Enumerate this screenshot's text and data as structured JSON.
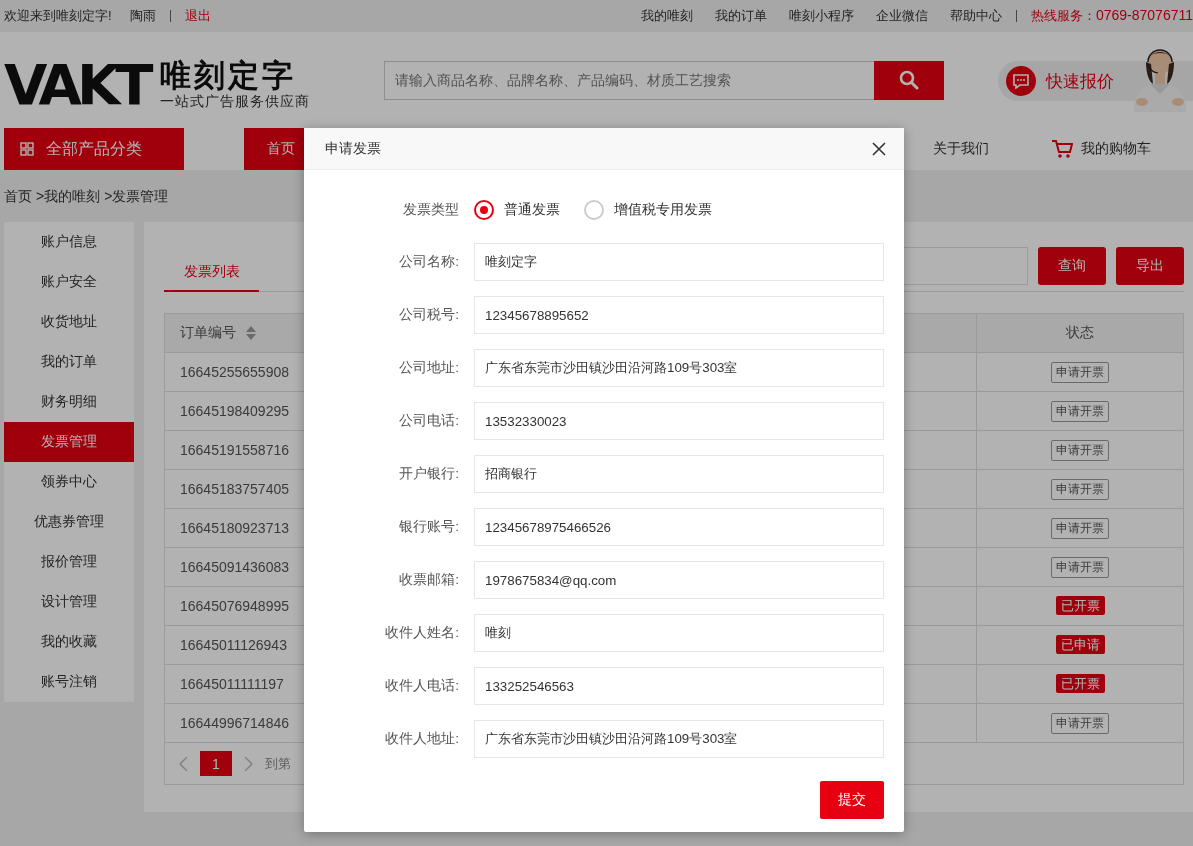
{
  "top_bar": {
    "welcome": "欢迎来到唯刻定字!",
    "username": "陶雨",
    "logout": "退出",
    "links": [
      "我的唯刻",
      "我的订单",
      "唯刻小程序",
      "企业微信",
      "帮助中心"
    ],
    "hotline_label": "热线服务：",
    "hotline": "0769-87076711"
  },
  "header": {
    "logo_mark": "VAKT",
    "logo_name": "唯刻定字",
    "slogan": "一站式广告服务供应商",
    "search": {
      "placeholder": "请输入商品名称、品牌名称、产品编码、材质工艺搜索"
    },
    "quick_quote": "快速报价"
  },
  "nav": {
    "category_button": "全部产品分类",
    "items": [
      {
        "label": "首页",
        "selected": true
      },
      {
        "label": "关于我们",
        "selected": false
      }
    ],
    "cart": "我的购物车"
  },
  "breadcrumb": [
    "首页",
    ">我的唯刻",
    ">发票管理"
  ],
  "sidebar": {
    "items": [
      {
        "label": "账户信息",
        "selected": false
      },
      {
        "label": "账户安全",
        "selected": false
      },
      {
        "label": "收货地址",
        "selected": false
      },
      {
        "label": "我的订单",
        "selected": false
      },
      {
        "label": "财务明细",
        "selected": false
      },
      {
        "label": "发票管理",
        "selected": true
      },
      {
        "label": "领券中心",
        "selected": false
      },
      {
        "label": "优惠券管理",
        "selected": false
      },
      {
        "label": "报价管理",
        "selected": false
      },
      {
        "label": "设计管理",
        "selected": false
      },
      {
        "label": "我的收藏",
        "selected": false
      },
      {
        "label": "账号注销",
        "selected": false
      }
    ]
  },
  "content": {
    "tabs": [
      {
        "label": "发票列表",
        "selected": true
      }
    ],
    "buttons": [
      "查询",
      "导出"
    ],
    "table": {
      "columns": [
        "订单编号",
        "状态"
      ],
      "rows": [
        {
          "order_no": "16645255655908",
          "status": "申请开票",
          "kind": "button"
        },
        {
          "order_no": "16645198409295",
          "status": "申请开票",
          "kind": "button"
        },
        {
          "order_no": "16645191558716",
          "status": "申请开票",
          "kind": "button"
        },
        {
          "order_no": "16645183757405",
          "status": "申请开票",
          "kind": "button"
        },
        {
          "order_no": "16645180923713",
          "status": "申请开票",
          "kind": "button"
        },
        {
          "order_no": "16645091436083",
          "status": "申请开票",
          "kind": "button"
        },
        {
          "order_no": "16645076948995",
          "status": "已开票",
          "kind": "badge"
        },
        {
          "order_no": "16645011126943",
          "status": "已申请",
          "kind": "badge"
        },
        {
          "order_no": "16645011111197",
          "status": "已开票",
          "kind": "badge"
        },
        {
          "order_no": "16644996714846",
          "status": "申请开票",
          "kind": "button"
        }
      ]
    },
    "pagination": {
      "pages": [
        {
          "label": "1",
          "selected": true
        }
      ],
      "goto": "到第"
    }
  },
  "dialog": {
    "title": "申请发票",
    "type_label": "发票类型",
    "type_options": [
      {
        "label": "普通发票",
        "selected": true
      },
      {
        "label": "增值税专用发票",
        "selected": false
      }
    ],
    "fields": [
      {
        "label": "公司名称:",
        "value": "唯刻定字"
      },
      {
        "label": "公司税号:",
        "value": "12345678895652"
      },
      {
        "label": "公司地址:",
        "value": "广东省东莞市沙田镇沙田沿河路109号303室"
      },
      {
        "label": "公司电话:",
        "value": "13532330023"
      },
      {
        "label": "开户银行:",
        "value": "招商银行"
      },
      {
        "label": "银行账号:",
        "value": "12345678975466526"
      },
      {
        "label": "收票邮箱:",
        "value": "1978675834@qq.com"
      },
      {
        "label": "收件人姓名:",
        "value": "唯刻"
      },
      {
        "label": "收件人电话:",
        "value": "133252546563"
      },
      {
        "label": "收件人地址:",
        "value": "广东省东莞市沙田镇沙田沿河路109号303室"
      }
    ],
    "submit": "提交"
  }
}
